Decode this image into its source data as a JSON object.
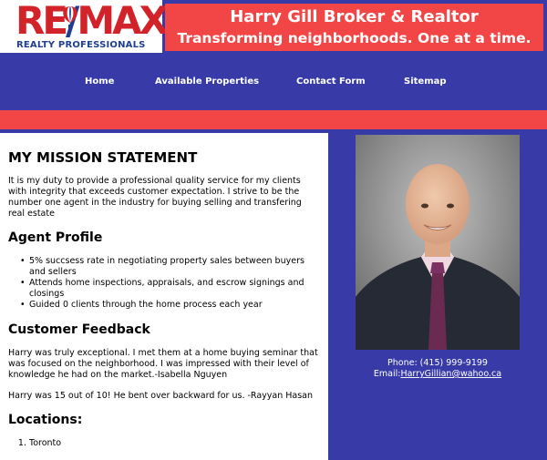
{
  "logo": {
    "brand_left": "RE",
    "brand_slash": "/",
    "brand_right": "MAX",
    "tagline": "REALTY PROFESSIONALS"
  },
  "banner": {
    "title": "Harry Gill Broker & Realtor",
    "subtitle": "Transforming neighborhoods. One at a time."
  },
  "nav": {
    "home": "Home",
    "properties": "Available Properties",
    "contact": "Contact Form",
    "sitemap": "Sitemap"
  },
  "main": {
    "mission_heading": "MY MISSION STATEMENT",
    "mission_text": "It is my duty to provide a professional quality service for my clients with integrity that exceeds customer expectation. I strive to be the number one agent in the industry for buying selling and transfering real estate",
    "profile_heading": "Agent Profile",
    "profile_items": [
      "5% succsess rate in negotiating property sales between buyers and sellers",
      "Attends home inspections, appraisals, and escrow signings and closings",
      "Guided 0 clients through the home process each year"
    ],
    "feedback_heading": "Customer Feedback",
    "feedback_1": "Harry was truly exceptional. I met them at a home buying seminar that was focused on the neighborhood. I was impressed with their level of knowledge he had on the market.-Isabella Nguyen",
    "feedback_2": "Harry was 15 out of 10! He bent over backward for us. -Rayyan Hasan",
    "locations_heading": "Locations:",
    "locations": [
      "Toronto"
    ]
  },
  "sidebar": {
    "phone": "Phone: (415) 999-9199",
    "email_label": "Email:",
    "email": "HarryGillian@wahoo.ca"
  },
  "colors": {
    "nav_blue": "#383ba7",
    "accent_red": "#f24545",
    "remax_red": "#d2232a",
    "remax_blue": "#1f3e92"
  }
}
